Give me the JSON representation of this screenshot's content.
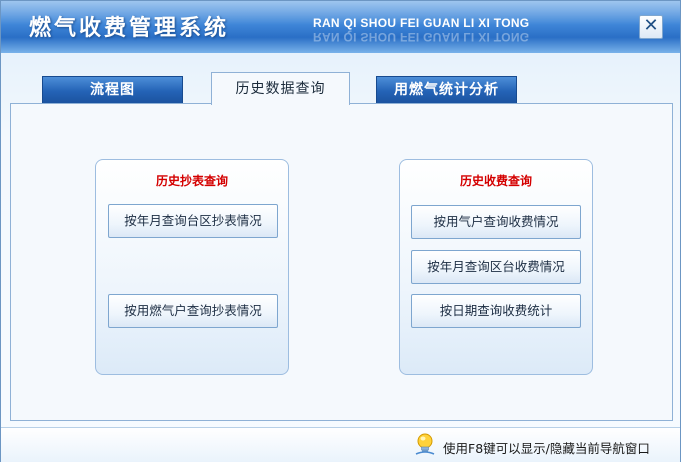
{
  "window": {
    "title": "燃气收费管理系统",
    "subtitle": "RAN QI  SHOU FEI GUAN LI XI TONG",
    "close_glyph": "✕"
  },
  "tabs": [
    {
      "label": "流程图",
      "active": false
    },
    {
      "label": "历史数据查询",
      "active": true
    },
    {
      "label": "用燃气统计分析",
      "active": false
    }
  ],
  "groups": {
    "meter_history": {
      "title": "历史抄表查询",
      "buttons": [
        "按年月查询台区抄表情况",
        "按用燃气户查询抄表情况"
      ]
    },
    "billing_history": {
      "title": "历史收费查询",
      "buttons": [
        "按用气户查询收费情况",
        "按年月查询区台收费情况",
        "按日期查询收费统计"
      ]
    }
  },
  "status": {
    "hint": "使用F8键可以显示/隐藏当前导航窗口",
    "icon": "lightbulb-icon"
  },
  "colors": {
    "title_bar": "#3f86d8",
    "tab_blue": "#2463b6",
    "group_title_red": "#d40000"
  }
}
